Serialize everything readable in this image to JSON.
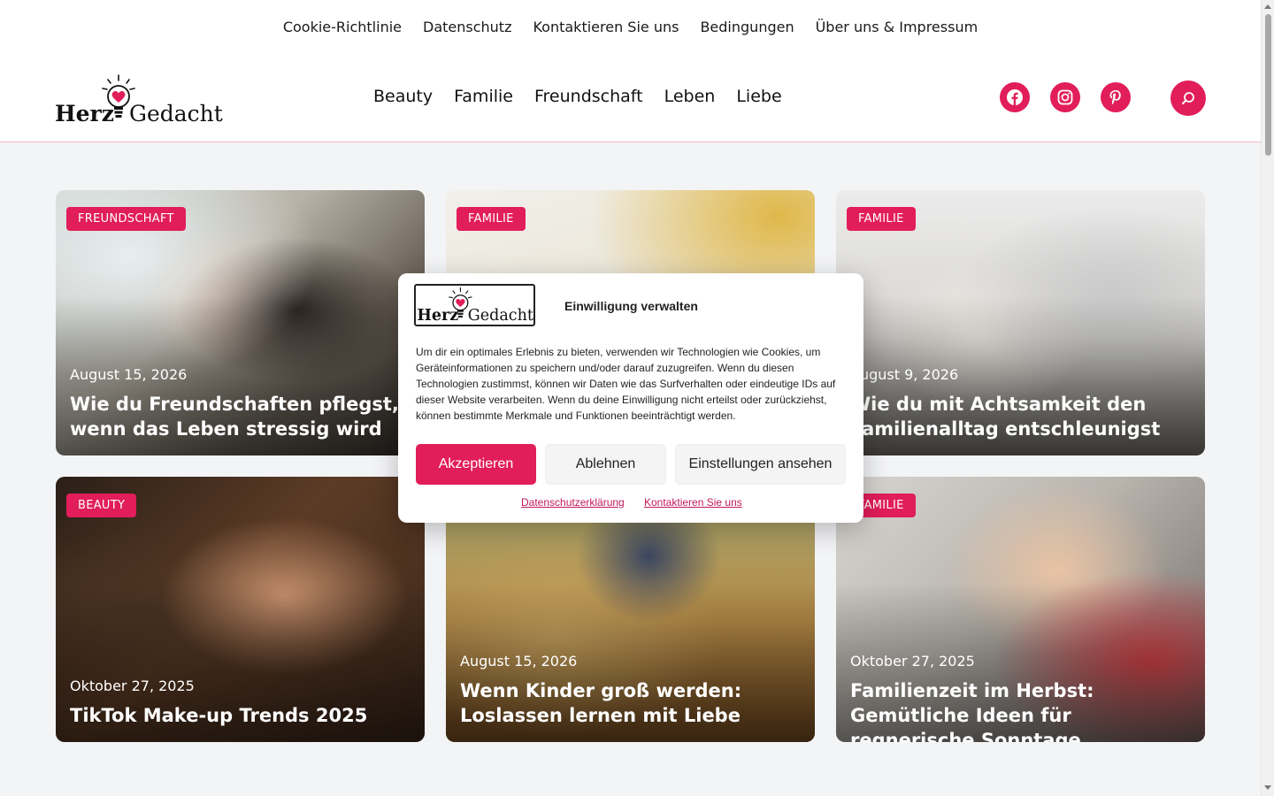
{
  "top_nav": [
    "Cookie-Richtlinie",
    "Datenschutz",
    "Kontaktieren Sie uns",
    "Bedingungen",
    "Über uns & Impressum"
  ],
  "logo": {
    "part1": "Herz",
    "part2": "Gedacht"
  },
  "main_nav": [
    "Beauty",
    "Familie",
    "Freundschaft",
    "Leben",
    "Liebe"
  ],
  "social": [
    "facebook-icon",
    "instagram-icon",
    "pinterest-icon"
  ],
  "colors": {
    "accent": "#e11d5a",
    "link": "#c2185b"
  },
  "cards": [
    {
      "badge": "FREUNDSCHAFT",
      "date": "August 15, 2026",
      "title": "Wie du Freundschaften pflegst, wenn das Leben stressig wird"
    },
    {
      "badge": "FAMILIE",
      "date": "",
      "title": ""
    },
    {
      "badge": "FAMILIE",
      "date": "August 9, 2026",
      "title": "Wie du mit Achtsamkeit den Familienalltag entschleunigst"
    },
    {
      "badge": "BEAUTY",
      "date": "Oktober 27, 2025",
      "title": "TikTok Make-up Trends 2025"
    },
    {
      "badge": "",
      "date": "August 15, 2026",
      "title": "Wenn Kinder groß werden: Loslassen lernen mit Liebe"
    },
    {
      "badge": "FAMILIE",
      "date": "Oktober 27, 2025",
      "title": "Familienzeit im Herbst: Gemütliche Ideen für regnerische Sonntage"
    }
  ],
  "consent": {
    "title": "Einwilligung verwalten",
    "text": "Um dir ein optimales Erlebnis zu bieten, verwenden wir Technologien wie Cookies, um Geräteinformationen zu speichern und/oder darauf zuzugreifen. Wenn du diesen Technologien zustimmst, können wir Daten wie das Surfverhalten oder eindeutige IDs auf dieser Website verarbeiten. Wenn du deine Einwilligung nicht erteilst oder zurückziehst, können bestimmte Merkmale und Funktionen beeinträchtigt werden.",
    "accept": "Akzeptieren",
    "deny": "Ablehnen",
    "settings": "Einstellungen ansehen",
    "link_privacy": "Datenschutzerklärung",
    "link_contact": "Kontaktieren Sie uns"
  }
}
